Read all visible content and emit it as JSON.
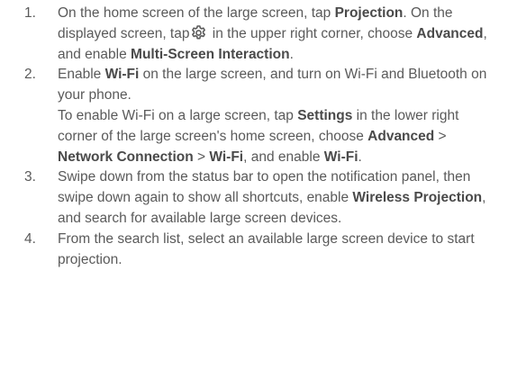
{
  "steps": [
    {
      "number": "1.",
      "p1": {
        "t1": "On the home screen of the large screen, tap ",
        "b1": "Projection",
        "t2": ". On the displayed screen, tap",
        "icon": "gear-icon",
        "t3": " in the upper right corner, choose ",
        "b2": "Advanced",
        "t4": ", and enable ",
        "b3": "Multi-Screen Interaction",
        "t5": "."
      }
    },
    {
      "number": "2.",
      "p1": {
        "t1": "Enable ",
        "b1": "Wi-Fi",
        "t2": " on the large screen, and turn on Wi-Fi and Bluetooth on your phone."
      },
      "p2": {
        "t1": "To enable Wi-Fi on a large screen, tap ",
        "b1": "Settings",
        "t2": " in the lower right corner of the large screen's home screen, choose ",
        "b2": "Advanced",
        "t3": " > ",
        "b3": "Network Connection",
        "t4": " > ",
        "b4": "Wi-Fi",
        "t5": ", and enable ",
        "b5": "Wi-Fi",
        "t6": "."
      }
    },
    {
      "number": "3.",
      "p1": {
        "t1": "Swipe down from the status bar to open the notification panel, then swipe down again to show all shortcuts, enable ",
        "b1": "Wireless Projection",
        "t2": ", and search for available large screen devices."
      }
    },
    {
      "number": "4.",
      "p1": {
        "t1": "From the search list, select an available large screen device to start projection."
      }
    }
  ]
}
